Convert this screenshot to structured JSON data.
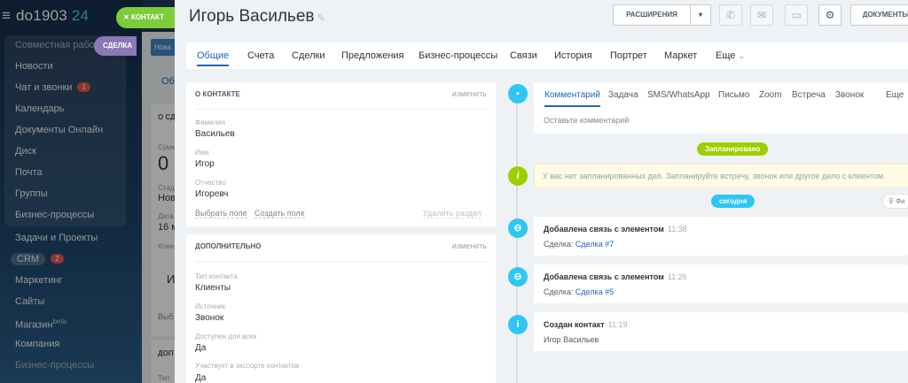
{
  "portal": {
    "name": "do1903",
    "suffix": "24"
  },
  "sidebar": {
    "items": [
      {
        "label": "Совместная работа",
        "dim": true
      },
      {
        "label": "Новости"
      },
      {
        "label": "Чат и звонки",
        "count": "1"
      },
      {
        "label": "Календарь"
      },
      {
        "label": "Документы Онлайн"
      },
      {
        "label": "Диск"
      },
      {
        "label": "Почта"
      },
      {
        "label": "Группы"
      },
      {
        "label": "Бизнес-процессы"
      },
      {
        "label": "Задачи и Проекты"
      },
      {
        "label": "CRM",
        "count": "2"
      },
      {
        "label": "Маркетинг"
      },
      {
        "label": "Сайты"
      },
      {
        "label": "Магазин",
        "sup": "beta"
      },
      {
        "label": "Компания"
      },
      {
        "label": "Бизнес-процессы",
        "dim": true
      }
    ]
  },
  "floating": {
    "contact_label": "КОНТАКТ",
    "deal_label": "СДЕЛКА"
  },
  "backpage": {
    "new_button": "Нова",
    "tab": "Общ",
    "card_title": "О СД",
    "sum_label": "Сумм",
    "sum_value": "0",
    "stage_label": "Стад",
    "stage_value": "Нов",
    "date_label": "Дата",
    "date_value": "16 м",
    "client_label": "Клие",
    "client_initial": "И",
    "select_link": "Выб",
    "additional": "ДОП",
    "type_label": "Тип"
  },
  "contact": {
    "full_name": "Игорь  Васильев",
    "header_buttons": {
      "extensions": "РАСШИРЕНИЯ",
      "documents": "ДОКУМЕНТЫ"
    },
    "tabs": [
      "Общие",
      "Счета",
      "Сделки",
      "Предложения",
      "Бизнес-процессы",
      "Связи",
      "История",
      "Портрет",
      "Маркет",
      "Еще"
    ],
    "about": {
      "title": "О КОНТАКТЕ",
      "edit": "изменить",
      "fields": [
        {
          "label": "Фамилия",
          "value": "Васильев"
        },
        {
          "label": "Имя",
          "value": "Игор"
        },
        {
          "label": "Отчество",
          "value": "Игоревч"
        }
      ],
      "select_field": "Выбрать поле",
      "create_field": "Создать поле",
      "delete_section": "Удалить раздел"
    },
    "additional": {
      "title": "ДОПОЛНИТЕЛЬНО",
      "edit": "изменить",
      "fields": [
        {
          "label": "Тип контакта",
          "value": "Клиенты"
        },
        {
          "label": "Источник",
          "value": "Звонок"
        },
        {
          "label": "Доступен для всех",
          "value": "Да"
        },
        {
          "label": "Участвует в экспорте контактов",
          "value": "Да"
        }
      ]
    }
  },
  "timeline": {
    "tabs": [
      "Комментарий",
      "Задача",
      "SMS/WhatsApp",
      "Письмо",
      "Zoom",
      "Встреча",
      "Звонок",
      "Еще"
    ],
    "comment_placeholder": "Оставьте комментарий",
    "planned_badge": "Запланировано",
    "planned_empty": "У вас нет запланированных дел. Запланируйте встречу, звонок или другое дело с клиентом.",
    "today_badge": "сегодня",
    "filter_label": "Фи",
    "events": [
      {
        "title": "Добавлена связь с элементом",
        "time": "11:38",
        "prefix": "Сделка:",
        "link": "Сделка #7"
      },
      {
        "title": "Добавлена связь с элементом",
        "time": "11:26",
        "prefix": "Сделка:",
        "link": "Сделка #5"
      },
      {
        "title": "Создан контакт",
        "time": "11:19",
        "body": "Игор Васильев"
      }
    ]
  },
  "colors": {
    "accent": "#2067b0",
    "green": "#9dcf00",
    "cyan": "#2fc6f6",
    "contact_pill": "#7ccc3c",
    "deal_pill": "#8a79b6"
  },
  "icons": [
    "burger-icon",
    "close-icon",
    "pencil-icon",
    "chevron-down-icon",
    "phone-icon",
    "mail-icon",
    "chat-icon",
    "gear-icon",
    "comment-icon",
    "info-icon",
    "link-icon",
    "filter-icon"
  ]
}
